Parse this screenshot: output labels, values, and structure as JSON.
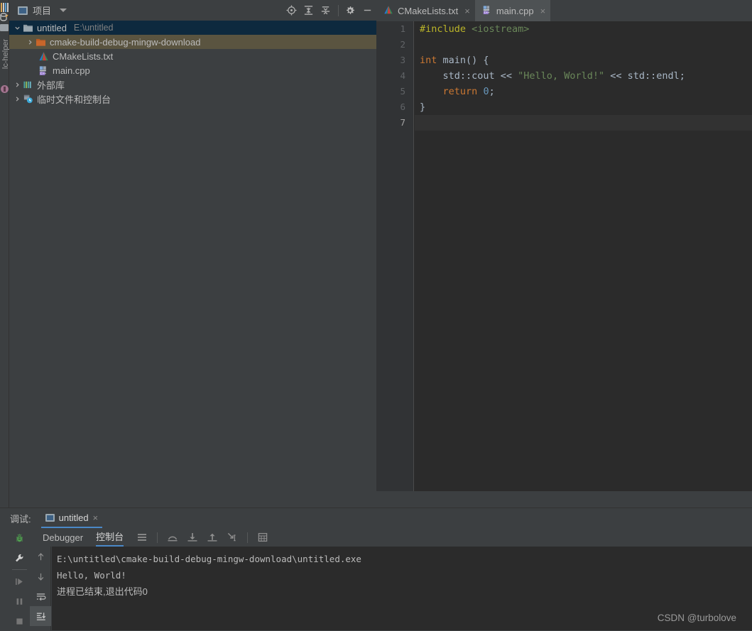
{
  "left_rail": {
    "vertical_label": "lc-helper",
    "icons": [
      "library-icon",
      "database-icon",
      "folder-icon",
      "plugin-dot-icon"
    ]
  },
  "project_panel": {
    "title": "项目",
    "dropdown_icon": "chevron-down-icon",
    "panel_icon": "project-panel-icon",
    "toolbar": [
      {
        "name": "select-opened-file-icon",
        "label": ""
      },
      {
        "name": "expand-all-icon",
        "label": ""
      },
      {
        "name": "collapse-all-icon",
        "label": ""
      },
      {
        "name": "settings-gear-icon",
        "label": ""
      },
      {
        "name": "hide-panel-icon",
        "label": ""
      }
    ],
    "tree": [
      {
        "label": "untitled",
        "sub": "E:\\untitled",
        "icon": "folder-module-icon",
        "arrow": "chevron-down-icon",
        "indent": 1,
        "state": "expanded",
        "highlight": "blue"
      },
      {
        "label": "cmake-build-debug-mingw-download",
        "sub": "",
        "icon": "folder-excluded-icon",
        "arrow": "chevron-right-icon",
        "indent": 2,
        "state": "collapsed",
        "highlight": "olive"
      },
      {
        "label": "CMakeLists.txt",
        "sub": "",
        "icon": "cmake-file-icon",
        "arrow": "none",
        "indent": 3,
        "state": "leaf",
        "highlight": "none"
      },
      {
        "label": "main.cpp",
        "sub": "",
        "icon": "cpp-file-icon",
        "arrow": "none",
        "indent": 3,
        "state": "leaf",
        "highlight": "none"
      },
      {
        "label": "外部库",
        "sub": "",
        "icon": "external-libraries-icon",
        "arrow": "chevron-right-icon",
        "indent": 1,
        "state": "collapsed",
        "highlight": "none"
      },
      {
        "label": "临时文件和控制台",
        "sub": "",
        "icon": "scratches-consoles-icon",
        "arrow": "chevron-right-icon",
        "indent": 1,
        "state": "collapsed",
        "highlight": "none"
      }
    ]
  },
  "editor": {
    "tabs": [
      {
        "label": "CMakeLists.txt",
        "icon": "cmake-file-icon",
        "active": false,
        "close": "×"
      },
      {
        "label": "main.cpp",
        "icon": "cpp-file-icon",
        "active": true,
        "close": "×"
      }
    ],
    "line_numbers": [
      "1",
      "2",
      "3",
      "4",
      "5",
      "6",
      "7"
    ],
    "caret_line": 7,
    "lines": [
      {
        "n": 1,
        "tokens": [
          {
            "t": "#include ",
            "c": "macro"
          },
          {
            "t": "<iostream>",
            "c": "inc"
          }
        ]
      },
      {
        "n": 2,
        "tokens": []
      },
      {
        "n": 3,
        "tokens": [
          {
            "t": "int",
            "c": "kw"
          },
          {
            "t": " main() {",
            "c": "def"
          }
        ]
      },
      {
        "n": 4,
        "tokens": [
          {
            "t": "    std::cout << ",
            "c": "def"
          },
          {
            "t": "\"Hello, World!\"",
            "c": "str"
          },
          {
            "t": " << std::endl;",
            "c": "def"
          }
        ]
      },
      {
        "n": 5,
        "tokens": [
          {
            "t": "    ",
            "c": "def"
          },
          {
            "t": "return",
            "c": "kw"
          },
          {
            "t": " ",
            "c": "def"
          },
          {
            "t": "0",
            "c": "num"
          },
          {
            "t": ";",
            "c": "def"
          }
        ]
      },
      {
        "n": 6,
        "tokens": [
          {
            "t": "}",
            "c": "def"
          }
        ]
      },
      {
        "n": 7,
        "tokens": []
      }
    ]
  },
  "debug": {
    "header_label": "调试:",
    "session_tab": "untitled",
    "session_tab_close": "×",
    "session_tab_icon": "run-configuration-icon",
    "rail_buttons": [
      {
        "name": "debug-bug-icon"
      },
      {
        "name": "wrench-settings-icon"
      },
      {
        "name": "resume-program-icon"
      },
      {
        "name": "pause-program-icon"
      },
      {
        "name": "stop-program-icon"
      }
    ],
    "tabs": [
      {
        "label": "Debugger",
        "active": false
      },
      {
        "label": "控制台",
        "active": true
      }
    ],
    "toolbar_icons": [
      {
        "name": "show-execution-point-icon"
      },
      {
        "name": "step-over-icon"
      },
      {
        "name": "step-into-icon"
      },
      {
        "name": "step-out-icon"
      },
      {
        "name": "run-to-cursor-icon"
      },
      {
        "name": "evaluate-expression-icon"
      }
    ],
    "console_rail": [
      {
        "name": "scroll-up-icon",
        "active": false
      },
      {
        "name": "scroll-down-icon",
        "active": false
      },
      {
        "name": "soft-wrap-icon",
        "active": false
      },
      {
        "name": "scroll-to-end-icon",
        "active": true
      }
    ],
    "console_lines": [
      {
        "text": "E:\\untitled\\cmake-build-debug-mingw-download\\untitled.exe",
        "cn": false
      },
      {
        "text": "Hello, World!",
        "cn": false
      },
      {
        "text": "",
        "cn": false
      },
      {
        "text": "进程已结束,退出代码0",
        "cn": true
      }
    ]
  },
  "watermark": "CSDN @turbolove",
  "colors": {
    "panel_bg": "#3c3f41",
    "editor_bg": "#2b2b2b",
    "gutter_bg": "#313335",
    "tree_selected_blue": "#0d293e",
    "tree_selected_olive": "#5a5440",
    "accent_blue": "#4a88c7",
    "keyword": "#cc7832",
    "string": "#6a8759",
    "number": "#6897bb",
    "macro": "#bbb529",
    "text": "#a9b7c6"
  }
}
